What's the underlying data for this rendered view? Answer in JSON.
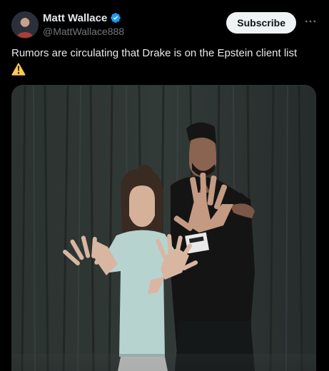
{
  "post": {
    "author": {
      "display_name": "Matt Wallace",
      "handle": "@MattWallace888",
      "verified": true,
      "avatar_icon": "avatar-image"
    },
    "subscribe_label": "Subscribe",
    "more_icon": "more-horizontal-icon",
    "text": "Rumors are circulating that Drake is on the Epstein client list",
    "emoji_icon": "warning-icon",
    "media_icon": "photo-image"
  },
  "colors": {
    "background": "#000000",
    "text_primary": "#e7e9ea",
    "text_secondary": "#71767b",
    "verified_blue": "#1d9bf0",
    "button_bg": "#eff3f4",
    "button_text": "#0f1419",
    "warning_yellow": "#ffcc4d"
  }
}
